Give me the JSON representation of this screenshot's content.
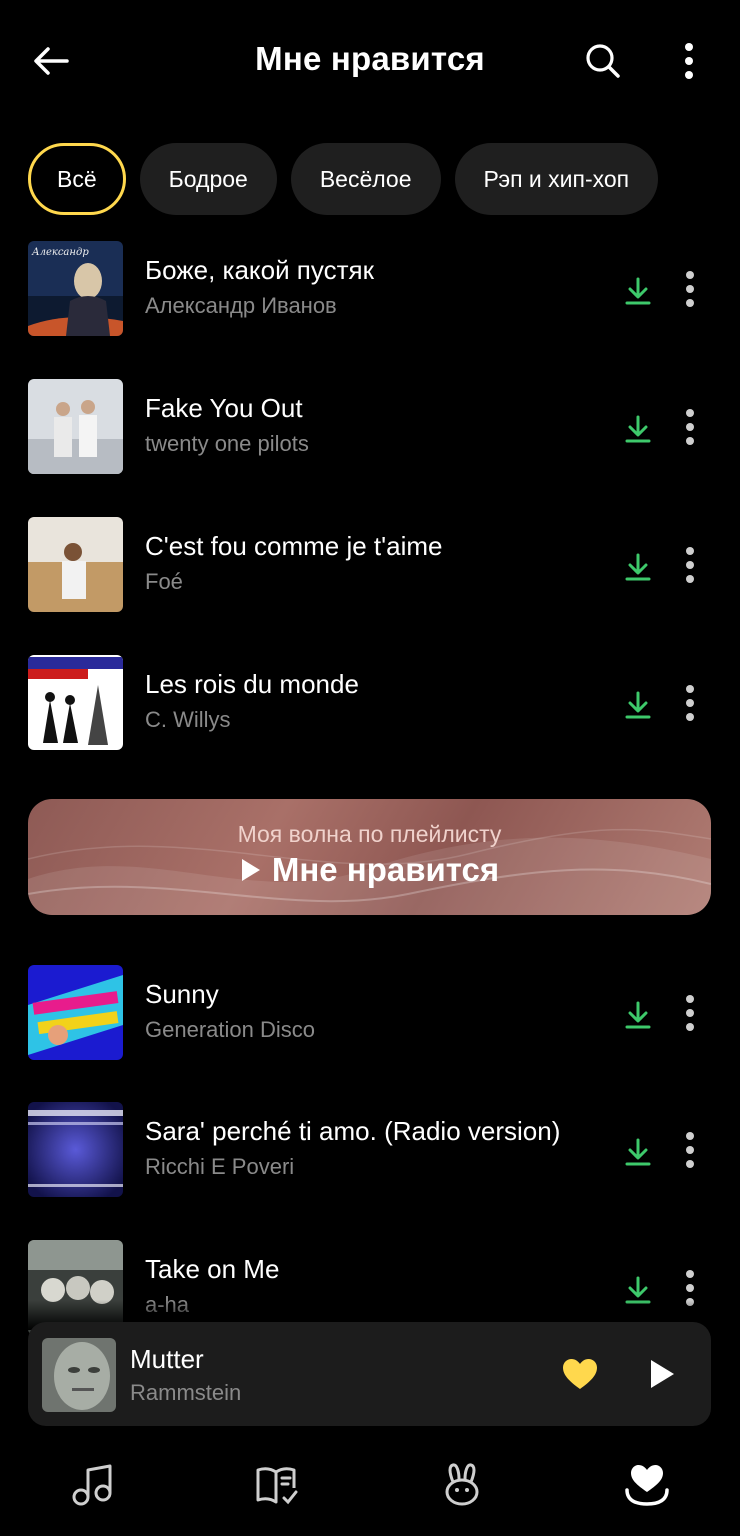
{
  "header": {
    "title": "Мне нравится",
    "back_icon": "arrow-left-icon",
    "search_icon": "search-icon",
    "menu_icon": "more-vertical-icon"
  },
  "filters": [
    {
      "label": "Всё",
      "active": true
    },
    {
      "label": "Бодрое",
      "active": false
    },
    {
      "label": "Весёлое",
      "active": false
    },
    {
      "label": "Рэп и хип-хоп",
      "active": false
    }
  ],
  "tracks": [
    {
      "title": "Боже, какой пустяк",
      "artist": "Александр Иванов"
    },
    {
      "title": "Fake You Out",
      "artist": "twenty one pilots"
    },
    {
      "title": "C'est fou comme je t'aime",
      "artist": "Foé"
    },
    {
      "title": "Les rois du monde",
      "artist": "C. Willys"
    },
    {
      "title": "Sunny",
      "artist": "Generation Disco"
    },
    {
      "title": "Sara' perché ti amo. (Radio version)",
      "artist": "Ricchi E Poveri"
    },
    {
      "title": "Take on Me",
      "artist": "a-ha"
    }
  ],
  "wave_banner": {
    "subtitle": "Моя волна по плейлисту",
    "title": "Мне нравится"
  },
  "now_playing": {
    "title": "Mutter",
    "artist": "Rammstein",
    "liked": true
  },
  "colors": {
    "accent": "#ffd84d",
    "download": "#3ec96b",
    "muted_text": "#8a8a8a"
  },
  "tabs": [
    {
      "name": "music-note-icon"
    },
    {
      "name": "book-icon"
    },
    {
      "name": "kids-bunny-icon"
    },
    {
      "name": "collection-heart-icon"
    }
  ]
}
